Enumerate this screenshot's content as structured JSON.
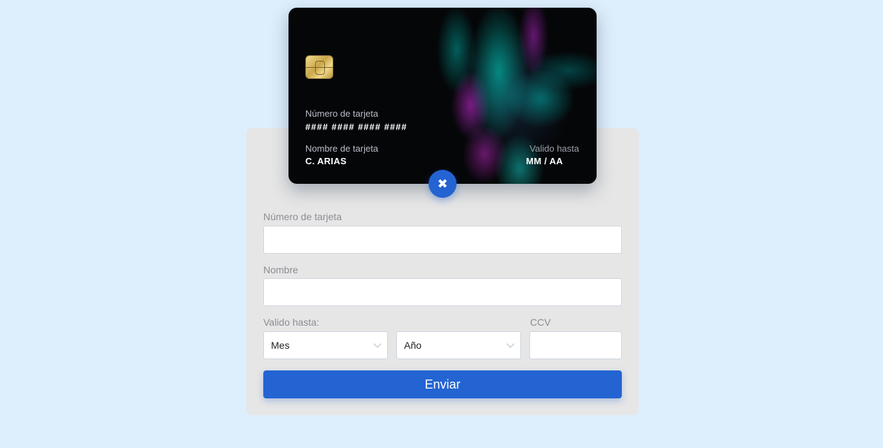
{
  "card": {
    "number_label": "Número de tarjeta",
    "number_value": "#### #### #### ####",
    "name_label": "Nombre de tarjeta",
    "name_value": "C. ARIAS",
    "expiry_label": "Valido hasta",
    "expiry_value": "MM / AA"
  },
  "toggle": {
    "icon": "close-icon",
    "glyph": "✖"
  },
  "form": {
    "number_label": "Número de tarjeta",
    "number_value": "",
    "name_label": "Nombre",
    "name_value": "",
    "expiry_label": "Valido hasta:",
    "month_selected": "Mes",
    "year_selected": "Año",
    "ccv_label": "CCV",
    "ccv_value": "",
    "submit_label": "Enviar"
  },
  "colors": {
    "background": "#ddeefc",
    "panel": "#e6e6e6",
    "accent": "#2364d2"
  }
}
